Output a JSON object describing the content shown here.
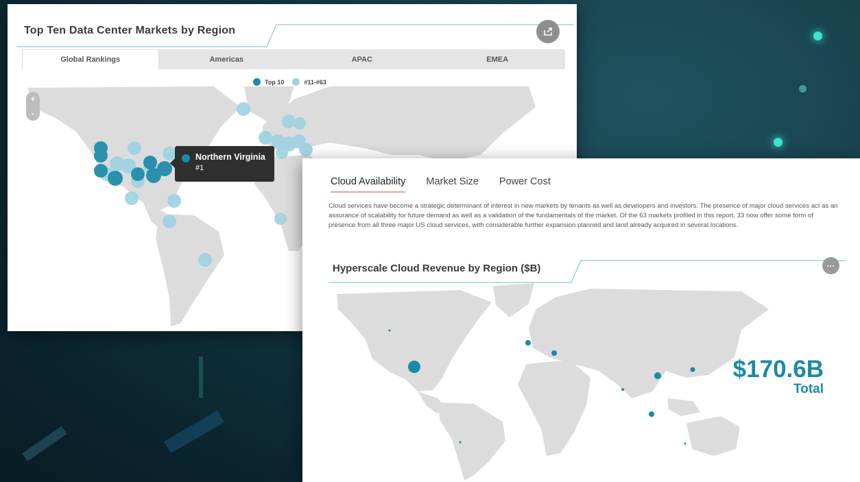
{
  "colors": {
    "accent": "#1b8aa7",
    "accent_light": "#9fd3e2",
    "land": "#dcdcdc",
    "tooltip_bg": "#2f2f2f"
  },
  "panel1": {
    "title": "Top Ten Data Center Markets by Region",
    "share_icon": "share-icon",
    "tabs": [
      {
        "label": "Global Rankings",
        "active": true
      },
      {
        "label": "Americas",
        "active": false
      },
      {
        "label": "APAC",
        "active": false
      },
      {
        "label": "EMEA",
        "active": false
      }
    ],
    "legend": [
      {
        "label": "Top 10",
        "color": "#1b8aa7"
      },
      {
        "label": "#11-#63",
        "color": "#9fd3e2"
      }
    ],
    "zoom": {
      "in_label": "+",
      "out_label": "-"
    },
    "tooltip": {
      "name": "Northern Virginia",
      "rank": "#1"
    }
  },
  "panel2": {
    "tabs": [
      {
        "label": "Cloud Availability",
        "active": true
      },
      {
        "label": "Market Size",
        "active": false
      },
      {
        "label": "Power Cost",
        "active": false
      }
    ],
    "paragraph": "Cloud services have become a strategic determinant of interest in new markets by tenants as well as developers and investors. The presence of major cloud services act as an assurance of scalability for future demand as well as a validation of the fundamentals of the market. Of the 63 markets profiled in this report, 33 now offer some form of presence from all three major US cloud services, with considerable further expansion planned and land already acquired in several locations.",
    "chart_title": "Hyperscale Cloud Revenue by Region ($B)",
    "more_label": "···",
    "total_value": "$170.6B",
    "total_label": "Total"
  }
}
